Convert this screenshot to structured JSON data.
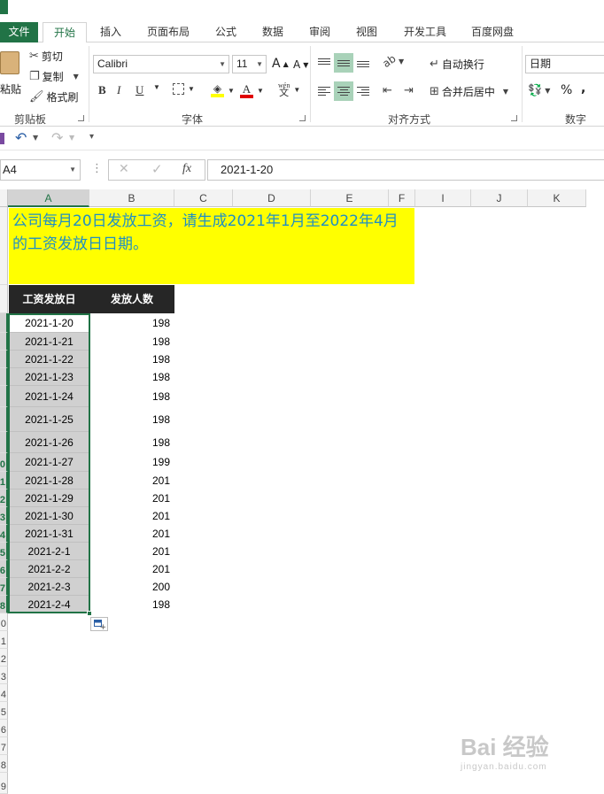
{
  "ribbon_tabs": [
    "文件",
    "开始",
    "插入",
    "页面布局",
    "公式",
    "数据",
    "审阅",
    "视图",
    "开发工具",
    "百度网盘"
  ],
  "clipboard": {
    "paste": "粘贴",
    "cut": "剪切",
    "copy": "复制",
    "format_painter": "格式刷",
    "group": "剪贴板"
  },
  "font": {
    "name": "Calibri",
    "size": "11",
    "bold": "B",
    "italic": "I",
    "underline": "U",
    "grow": "A",
    "shrink": "A",
    "phonetic": "wén",
    "group": "字体"
  },
  "alignment": {
    "wrap_text": "自动换行",
    "merge_center": "合并后居中",
    "group": "对齐方式"
  },
  "number": {
    "format": "日期",
    "percent": "%",
    "comma": ",",
    "group": "数字"
  },
  "namebox": "A4",
  "formula": {
    "cancel": "✕",
    "enter": "✓",
    "fx": "fx",
    "value": "2021-1-20"
  },
  "columns": [
    "A",
    "B",
    "C",
    "D",
    "E",
    "F",
    "I",
    "J",
    "K"
  ],
  "row_numbers": [
    "",
    "",
    "",
    "",
    "",
    "",
    "",
    "",
    "",
    "0",
    "1",
    "2",
    "3",
    "4",
    "5",
    "6",
    "7",
    "8",
    "9",
    "0",
    "1",
    "2",
    "3",
    "4",
    "5",
    "6",
    "7",
    "8",
    "9"
  ],
  "sheet": {
    "banner": "公司每月20日发放工资，请生成2021年1月至2022年4月的工资发放日日期。",
    "headers": [
      "工资发放日",
      "发放人数"
    ],
    "rows": [
      {
        "date": "2021-1-20",
        "count": "198"
      },
      {
        "date": "2021-1-21",
        "count": "198"
      },
      {
        "date": "2021-1-22",
        "count": "198"
      },
      {
        "date": "2021-1-23",
        "count": "198"
      },
      {
        "date": "2021-1-24",
        "count": "198"
      },
      {
        "date": "2021-1-25",
        "count": "198"
      },
      {
        "date": "2021-1-26",
        "count": "198"
      },
      {
        "date": "2021-1-27",
        "count": "199"
      },
      {
        "date": "2021-1-28",
        "count": "201"
      },
      {
        "date": "2021-1-29",
        "count": "201"
      },
      {
        "date": "2021-1-30",
        "count": "201"
      },
      {
        "date": "2021-1-31",
        "count": "201"
      },
      {
        "date": "2021-2-1",
        "count": "201"
      },
      {
        "date": "2021-2-2",
        "count": "201"
      },
      {
        "date": "2021-2-3",
        "count": "200"
      },
      {
        "date": "2021-2-4",
        "count": "198"
      }
    ]
  },
  "watermark": {
    "main": "Bai 经验",
    "sub": "jingyan.baidu.com"
  },
  "colors": {
    "excel_green": "#217346",
    "banner_bg": "#ffff00",
    "banner_text": "#1f8fc4",
    "header_bg": "#262626",
    "selection_fill": "#d0d0d0"
  }
}
